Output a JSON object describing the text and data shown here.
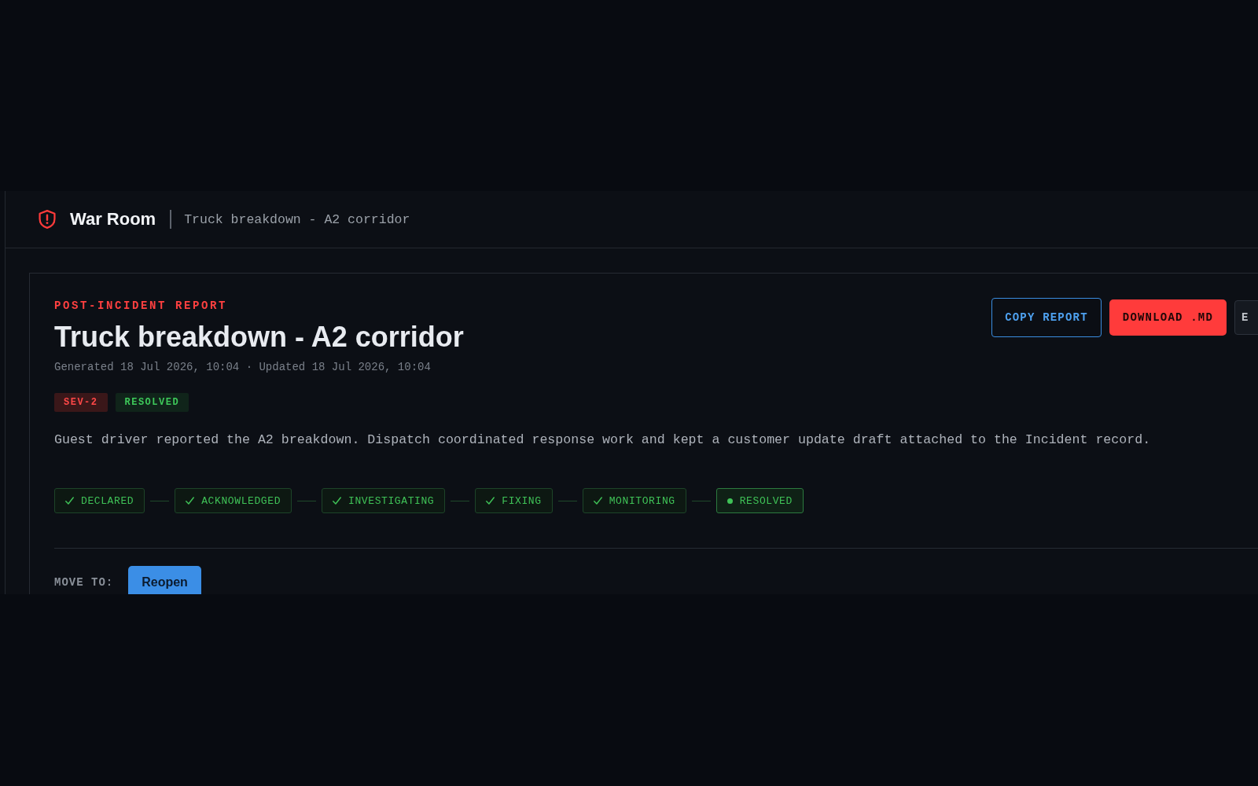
{
  "header": {
    "app_name": "War Room",
    "incident_title": "Truck breakdown - A2 corridor"
  },
  "report": {
    "eyebrow": "POST-INCIDENT REPORT",
    "title": "Truck breakdown - A2 corridor",
    "meta": "Generated 18 Jul 2026, 10:04 · Updated 18 Jul 2026, 10:04",
    "actions": [
      {
        "label": "COPY REPORT",
        "kind": "outline"
      },
      {
        "label": "DOWNLOAD .MD",
        "kind": "primary"
      },
      {
        "label": "E",
        "kind": "secondary"
      }
    ],
    "badges": [
      {
        "label": "SEV-2",
        "kind": "severity"
      },
      {
        "label": "RESOLVED",
        "kind": "status"
      }
    ],
    "summary": "Guest driver reported the A2 breakdown. Dispatch coordinated response work and kept a customer update draft attached to the Incident record.",
    "stages": [
      {
        "label": "DECLARED",
        "current": false
      },
      {
        "label": "ACKNOWLEDGED",
        "current": false
      },
      {
        "label": "INVESTIGATING",
        "current": false
      },
      {
        "label": "FIXING",
        "current": false
      },
      {
        "label": "MONITORING",
        "current": false
      },
      {
        "label": "RESOLVED",
        "current": true
      }
    ],
    "move_to": {
      "label": "MOVE TO:",
      "buttons": [
        {
          "label": "Reopen"
        }
      ]
    }
  }
}
